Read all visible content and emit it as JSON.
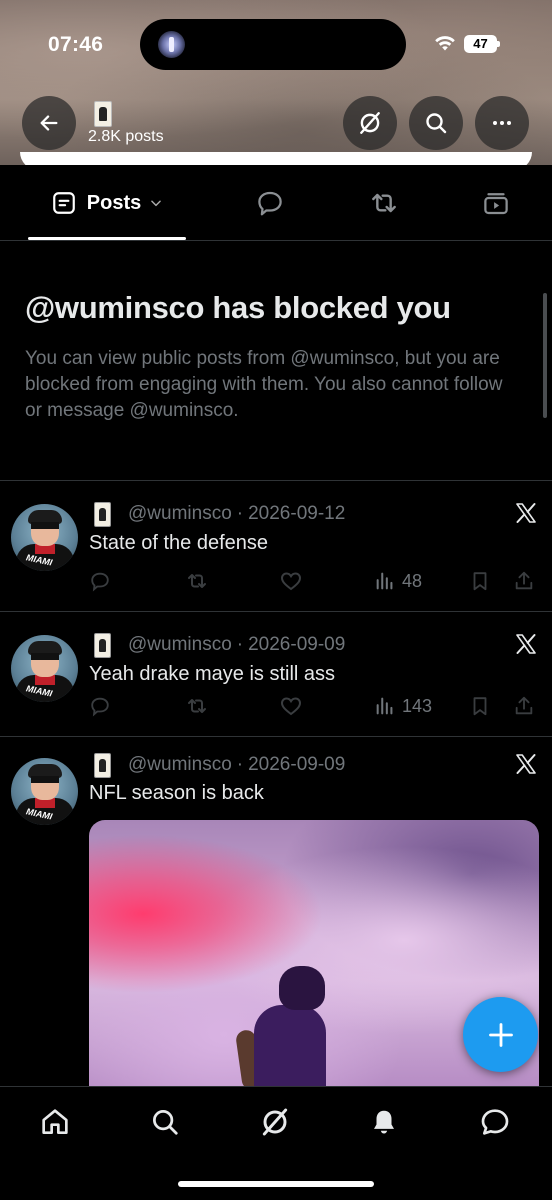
{
  "status_bar": {
    "time": "07:46",
    "battery": "47"
  },
  "header": {
    "posts_count": "2.8K posts",
    "back_icon": "arrow-left-icon",
    "grok_icon": "grok-icon",
    "search_icon": "search-icon",
    "more_icon": "more-horizontal-icon"
  },
  "tabs": {
    "posts_label": "Posts",
    "posts_icon": "posts-icon",
    "replies_icon": "reply-bubble-icon",
    "reposts_icon": "repost-icon",
    "media_icon": "media-icon"
  },
  "blocked": {
    "title": "@wuminsco has blocked you",
    "message": "You can view public posts from @wuminsco, but you are blocked from engaging with them. You also cannot follow or message @wuminsco."
  },
  "posts": [
    {
      "handle": "@wuminsco",
      "date": "2026-09-12",
      "text": "State of the defense",
      "views": "48"
    },
    {
      "handle": "@wuminsco",
      "date": "2026-09-09",
      "text": "Yeah drake maye is still ass",
      "views": "143"
    },
    {
      "handle": "@wuminsco",
      "date": "2026-09-09",
      "text": "NFL season is back"
    }
  ],
  "separator": "·",
  "colors": {
    "accent": "#1d9bf0",
    "background": "#000000",
    "text_primary": "#e7e9ea",
    "text_secondary": "#71767b",
    "divider": "#2f3336"
  },
  "bottom_nav": {
    "items": [
      "home-icon",
      "search-icon",
      "grok-icon",
      "bell-icon",
      "messages-icon"
    ]
  },
  "fab": {
    "icon": "plus-icon"
  }
}
